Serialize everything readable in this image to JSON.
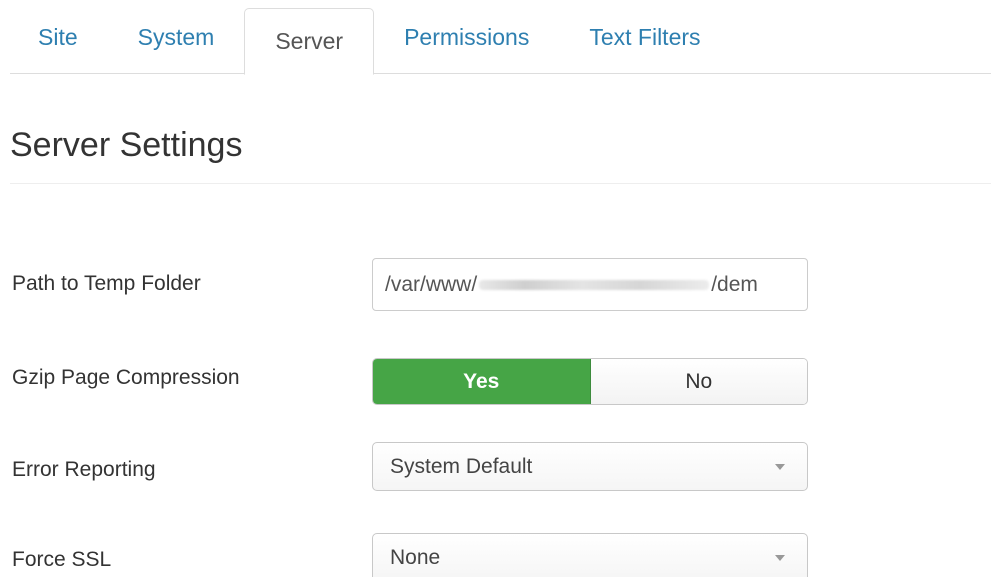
{
  "tabs": [
    {
      "label": "Site"
    },
    {
      "label": "System"
    },
    {
      "label": "Server"
    },
    {
      "label": "Permissions"
    },
    {
      "label": "Text Filters"
    }
  ],
  "active_tab": "Server",
  "section_title": "Server Settings",
  "fields": {
    "temp_path": {
      "label": "Path to Temp Folder",
      "value_prefix": "/var/www/",
      "value_suffix": "/dem"
    },
    "gzip": {
      "label": "Gzip Page Compression",
      "yes_label": "Yes",
      "no_label": "No",
      "selected": "Yes"
    },
    "error_reporting": {
      "label": "Error Reporting",
      "value": "System Default"
    },
    "force_ssl": {
      "label": "Force SSL",
      "value": "None"
    }
  },
  "colors": {
    "tab_link": "#2e7fb0",
    "toggle_on": "#46a546"
  }
}
